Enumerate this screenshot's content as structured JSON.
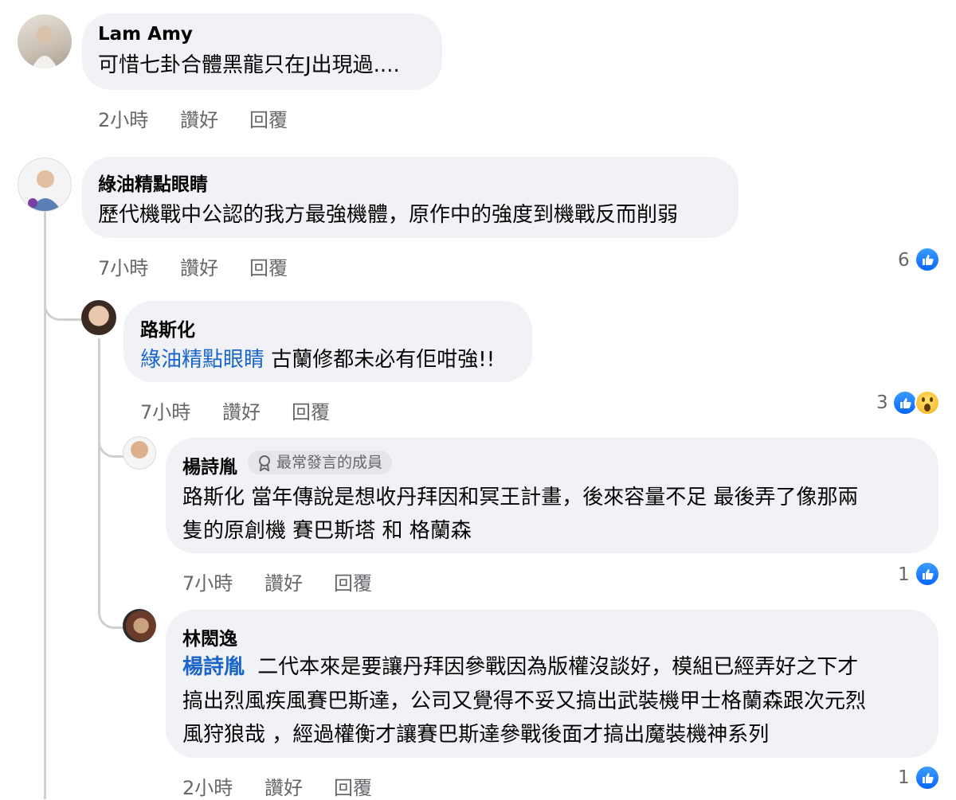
{
  "comments": [
    {
      "author": "Lam Amy",
      "text": "可惜七卦合體黑龍只在J出現過....",
      "time": "2小時",
      "like_label": "讚好",
      "reply_label": "回覆"
    },
    {
      "author": "綠油精點眼睛",
      "text": "歷代機戰中公認的我方最強機體，原作中的強度到機戰反而削弱",
      "time": "7小時",
      "like_label": "讚好",
      "reply_label": "回覆",
      "reaction_count": "6"
    },
    {
      "author": "路斯化",
      "mention": "綠油精點眼睛",
      "text": "古蘭修都未必有佢咁強!!",
      "time": "7小時",
      "like_label": "讚好",
      "reply_label": "回覆",
      "reaction_count": "3"
    },
    {
      "author": "楊詩胤",
      "badge": "最常發言的成員",
      "line1": "路斯化 當年傳說是想收丹拜因和冥王計畫，後來容量不足 最後弄了像那兩",
      "line2": "隻的原創機  賽巴斯塔 和 格蘭森",
      "time": "7小時",
      "like_label": "讚好",
      "reply_label": "回覆",
      "reaction_count": "1"
    },
    {
      "author": "林閎逸",
      "mention": "楊詩胤",
      "line1": "二代本來是要讓丹拜因參戰因為版權沒談好，模組已經弄好之下才",
      "line2": "搞出烈風疾風賽巴斯達，公司又覺得不妥又搞出武裝機甲士格蘭森跟次元烈",
      "line3": "風狩狼哉 ，經過權衡才讓賽巴斯達參戰後面才搞出魔裝機神系列",
      "time": "2小時",
      "like_label": "讚好",
      "reply_label": "回覆",
      "reaction_count": "1"
    }
  ],
  "colors": {
    "bubble": "#f0f2f5",
    "mention": "#1a65c9",
    "meta": "#65676b",
    "like": "#0866ff"
  }
}
